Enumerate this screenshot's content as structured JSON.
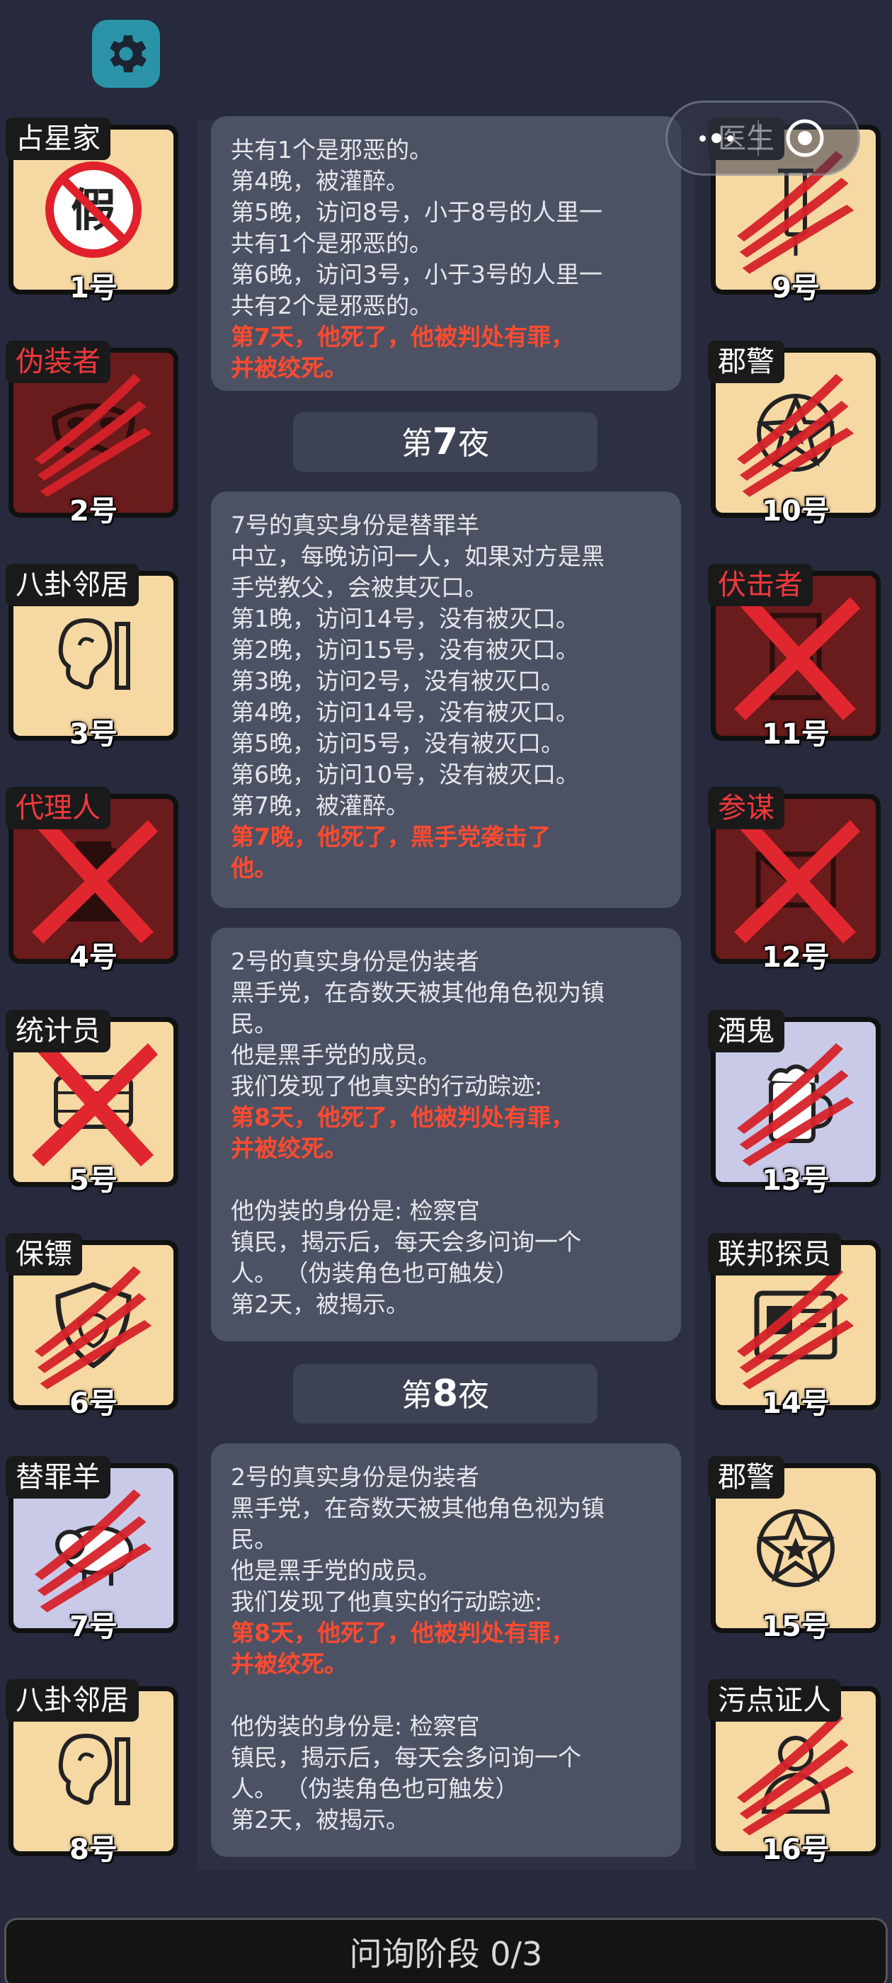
{
  "top": {
    "settings_icon": "gear-icon",
    "capsule_icons": [
      "more-dots-icon",
      "target-circle-icon"
    ]
  },
  "left_players": [
    {
      "role": "占星家",
      "number": "1号",
      "evil": false,
      "bg": "tan",
      "icon": "fake-prohibited-icon",
      "mark": "none"
    },
    {
      "role": "伪装者",
      "number": "2号",
      "evil": true,
      "bg": "red",
      "icon": "mask-icon",
      "mark": "claw"
    },
    {
      "role": "八卦邻居",
      "number": "3号",
      "evil": false,
      "bg": "tan",
      "icon": "ear-icon",
      "mark": "none"
    },
    {
      "role": "代理人",
      "number": "4号",
      "evil": true,
      "bg": "red",
      "icon": "agent-icon",
      "mark": "cross"
    },
    {
      "role": "统计员",
      "number": "5号",
      "evil": false,
      "bg": "tan",
      "icon": "abacus-icon",
      "mark": "cross"
    },
    {
      "role": "保镖",
      "number": "6号",
      "evil": false,
      "bg": "tan",
      "icon": "shield-icon",
      "mark": "claw"
    },
    {
      "role": "替罪羊",
      "number": "7号",
      "evil": false,
      "bg": "lav",
      "icon": "sheep-icon",
      "mark": "claw"
    },
    {
      "role": "八卦邻居",
      "number": "8号",
      "evil": false,
      "bg": "tan",
      "icon": "ear-icon",
      "mark": "none"
    }
  ],
  "right_players": [
    {
      "role": "医生",
      "number": "9号",
      "evil": false,
      "bg": "tan",
      "icon": "syringe-icon",
      "mark": "claw"
    },
    {
      "role": "郡警",
      "number": "10号",
      "evil": false,
      "bg": "tan",
      "icon": "sheriff-star-icon",
      "mark": "claw"
    },
    {
      "role": "伏击者",
      "number": "11号",
      "evil": true,
      "bg": "red",
      "icon": "door-icon",
      "mark": "cross"
    },
    {
      "role": "参谋",
      "number": "12号",
      "evil": true,
      "bg": "red",
      "icon": "envelope-icon",
      "mark": "cross"
    },
    {
      "role": "酒鬼",
      "number": "13号",
      "evil": false,
      "bg": "lav",
      "icon": "beer-mug-icon",
      "mark": "claw"
    },
    {
      "role": "联邦探员",
      "number": "14号",
      "evil": false,
      "bg": "tan",
      "icon": "badge-card-icon",
      "mark": "claw"
    },
    {
      "role": "郡警",
      "number": "15号",
      "evil": false,
      "bg": "tan",
      "icon": "sheriff-star-icon",
      "mark": "none"
    },
    {
      "role": "污点证人",
      "number": "16号",
      "evil": false,
      "bg": "tan",
      "icon": "witness-icon",
      "mark": "claw"
    }
  ],
  "log": {
    "panel1": [
      {
        "text": "共有1个是邪恶的。",
        "red": false
      },
      {
        "text": "第4晚，被灌醉。",
        "red": false
      },
      {
        "text": "第5晚，访问8号，小于8号的人里一",
        "red": false
      },
      {
        "text": "共有1个是邪恶的。",
        "red": false
      },
      {
        "text": "第6晚，访问3号，小于3号的人里一",
        "red": false
      },
      {
        "text": "共有2个是邪恶的。",
        "red": false
      },
      {
        "text": "第7天，他死了，他被判处有罪，",
        "red": true
      },
      {
        "text": "并被绞死。",
        "red": true
      }
    ],
    "night7_prefix": "第",
    "night7_num": "7",
    "night7_suffix": "夜",
    "panel2": [
      {
        "text": "7号的真实身份是替罪羊",
        "red": false
      },
      {
        "text": "中立，每晚访问一人，如果对方是黑",
        "red": false
      },
      {
        "text": "手党教父，会被其灭口。",
        "red": false
      },
      {
        "text": "第1晚，访问14号，没有被灭口。",
        "red": false
      },
      {
        "text": "第2晚，访问15号，没有被灭口。",
        "red": false
      },
      {
        "text": "第3晚，访问2号，没有被灭口。",
        "red": false
      },
      {
        "text": "第4晚，访问14号，没有被灭口。",
        "red": false
      },
      {
        "text": "第5晚，访问5号，没有被灭口。",
        "red": false
      },
      {
        "text": "第6晚，访问10号，没有被灭口。",
        "red": false
      },
      {
        "text": "第7晚，被灌醉。",
        "red": false
      },
      {
        "text": "第7晚，他死了，黑手党袭击了",
        "red": true
      },
      {
        "text": "他。",
        "red": true
      }
    ],
    "panel3": [
      {
        "text": "2号的真实身份是伪装者",
        "red": false
      },
      {
        "text": "黑手党，在奇数天被其他角色视为镇",
        "red": false
      },
      {
        "text": "民。",
        "red": false
      },
      {
        "text": "他是黑手党的成员。",
        "red": false
      },
      {
        "text": "我们发现了他真实的行动踪迹:",
        "red": false
      },
      {
        "text": "第8天，他死了，他被判处有罪，",
        "red": true
      },
      {
        "text": "并被绞死。",
        "red": true
      },
      {
        "text": "",
        "red": false
      },
      {
        "text": "他伪装的身份是: 检察官",
        "red": false
      },
      {
        "text": "镇民，揭示后，每天会多问询一个",
        "red": false
      },
      {
        "text": "人。 （伪装角色也可触发）",
        "red": false
      },
      {
        "text": "第2天，被揭示。",
        "red": false
      }
    ],
    "night8_prefix": "第",
    "night8_num": "8",
    "night8_suffix": "夜",
    "panel4": [
      {
        "text": "2号的真实身份是伪装者",
        "red": false
      },
      {
        "text": "黑手党，在奇数天被其他角色视为镇",
        "red": false
      },
      {
        "text": "民。",
        "red": false
      },
      {
        "text": "他是黑手党的成员。",
        "red": false
      },
      {
        "text": "我们发现了他真实的行动踪迹:",
        "red": false
      },
      {
        "text": "第8天，他死了，他被判处有罪，",
        "red": true
      },
      {
        "text": "并被绞死。",
        "red": true
      },
      {
        "text": "",
        "red": false
      },
      {
        "text": "他伪装的身份是: 检察官",
        "red": false
      },
      {
        "text": "镇民，揭示后，每天会多问询一个",
        "red": false
      },
      {
        "text": "人。 （伪装角色也可触发）",
        "red": false
      },
      {
        "text": "第2天，被揭示。",
        "red": false
      }
    ]
  },
  "bottom": {
    "phase_label": "问询阶段 0/3"
  },
  "colors": {
    "background": "#262a3c",
    "evil_role": "#f0383c",
    "death_text": "#ff4a30",
    "settings_button": "#2a93a8"
  }
}
